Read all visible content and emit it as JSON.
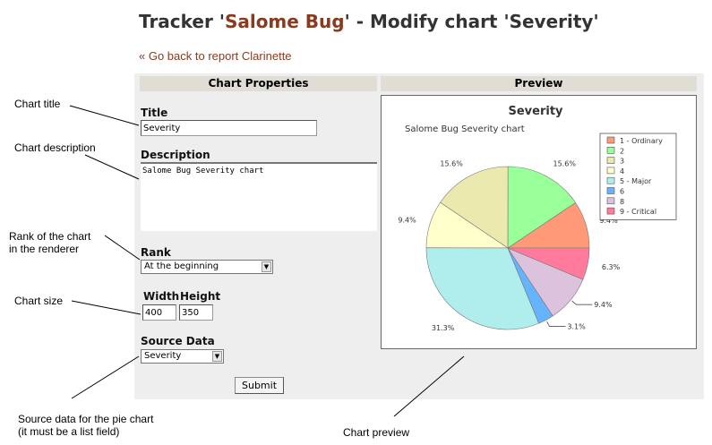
{
  "header": {
    "title_prefix": "Tracker '",
    "tracker_name": "Salome Bug",
    "title_suffix": "' - Modify chart 'Severity'",
    "back_link": "« Go back to report Clarinette"
  },
  "sections": {
    "properties": "Chart Properties",
    "preview": "Preview"
  },
  "form": {
    "title_label": "Title",
    "title_value": "Severity",
    "description_label": "Description",
    "description_value": "Salome Bug Severity chart",
    "rank_label": "Rank",
    "rank_value": "At the beginning",
    "width_label": "Width",
    "height_label": "Height",
    "width_value": "400",
    "height_value": "350",
    "source_label": "Source Data",
    "source_value": "Severity",
    "submit_label": "Submit"
  },
  "annotations": {
    "chart_title": "Chart title",
    "chart_description": "Chart description",
    "rank_line1": "Rank of the chart",
    "rank_line2": "in the renderer",
    "chart_size": "Chart size",
    "source_line1": "Source data for the pie chart",
    "source_line2": "(it must be a list field)",
    "chart_preview": "Chart preview"
  },
  "chart_data": {
    "type": "pie",
    "title": "Severity",
    "subtitle": "Salome Bug Severity chart",
    "legend_position": "top-right",
    "slices": [
      {
        "label": "1 - Ordinary",
        "percent": 9.4,
        "value_label": "9.4%",
        "color": "#ff9977"
      },
      {
        "label": "2",
        "percent": 15.6,
        "value_label": "15.6%",
        "color": "#99ff99"
      },
      {
        "label": "3",
        "percent": 15.6,
        "value_label": "15.6%",
        "color": "#ebe9ae"
      },
      {
        "label": "4",
        "percent": 9.4,
        "value_label": "9.4%",
        "color": "#ffffcc"
      },
      {
        "label": "5 - Major",
        "percent": 31.3,
        "value_label": "31.3%",
        "color": "#b0eeee"
      },
      {
        "label": "6",
        "percent": 3.1,
        "value_label": "3.1%",
        "color": "#66b3ff"
      },
      {
        "label": "8",
        "percent": 9.4,
        "value_label": "9.4%",
        "color": "#dcc2dc"
      },
      {
        "label": "9 - Critical",
        "percent": 6.3,
        "value_label": "6.3%",
        "color": "#ff7a9c"
      }
    ]
  }
}
